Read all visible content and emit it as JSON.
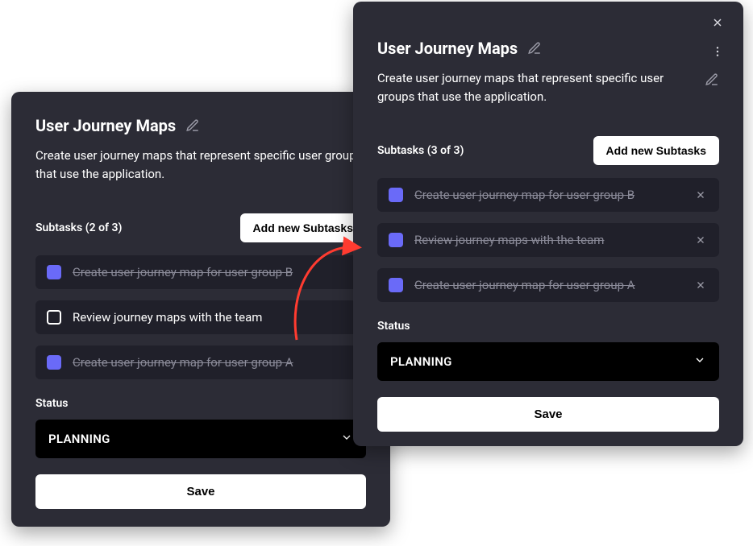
{
  "back": {
    "title": "User Journey Maps",
    "description": "Create user journey maps that represent specific user groups that use the application.",
    "subtasks_label": "Subtasks (2 of 3)",
    "add_button": "Add new Subtasks",
    "subtasks": [
      {
        "text": "Create user journey map for user group B",
        "done": true
      },
      {
        "text": "Review journey maps with the team",
        "done": false
      },
      {
        "text": "Create user journey map for user group A",
        "done": true
      }
    ],
    "status_label": "Status",
    "status_value": "PLANNING",
    "save_label": "Save"
  },
  "front": {
    "title": "User Journey Maps",
    "description": "Create user journey maps that represent specific user groups that use the application.",
    "subtasks_label": "Subtasks (3 of 3)",
    "add_button": "Add new Subtasks",
    "subtasks": [
      {
        "text": "Create user journey map for user group B",
        "done": true
      },
      {
        "text": "Review journey maps with the team",
        "done": true
      },
      {
        "text": "Create user journey map for user group A",
        "done": true
      }
    ],
    "status_label": "Status",
    "status_value": "PLANNING",
    "save_label": "Save"
  },
  "icons": {
    "edit": "edit-icon",
    "close": "close-icon",
    "kebab": "kebab-icon",
    "chevron": "chevron-down-icon",
    "remove": "remove-icon"
  }
}
